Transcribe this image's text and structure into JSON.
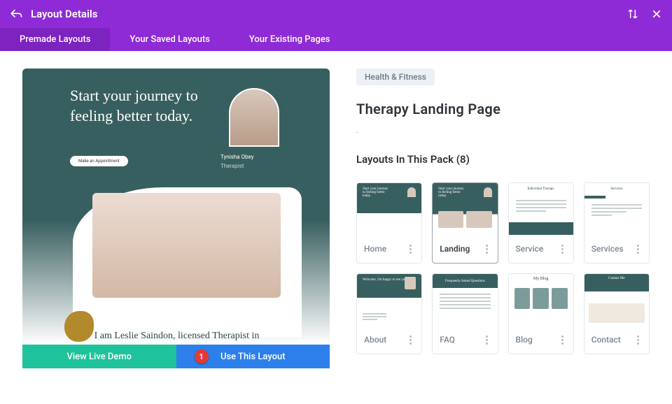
{
  "header": {
    "title": "Layout Details"
  },
  "tabs": [
    {
      "label": "Premade Layouts",
      "active": true
    },
    {
      "label": "Your Saved Layouts",
      "active": false
    },
    {
      "label": "Your Existing Pages",
      "active": false
    }
  ],
  "preview": {
    "heading": "Start your journey to feeling better today.",
    "cta_pill": "Make an Appointment",
    "person_name": "Tynisha Obey",
    "person_role": "Therapist",
    "subtitle": "I am Leslie Saindon, licensed Therapist in"
  },
  "buttons": {
    "demo": "View Live Demo",
    "use": "Use This Layout",
    "marker": "1"
  },
  "details": {
    "category": "Health & Fitness",
    "title": "Therapy Landing Page",
    "subdot": ".",
    "pack_label": "Layouts In This Pack (8)"
  },
  "pack": [
    {
      "label": "Home",
      "thumb": "t-home",
      "active": false
    },
    {
      "label": "Landing",
      "thumb": "t-landing",
      "active": true
    },
    {
      "label": "Service",
      "thumb": "t-service",
      "active": false
    },
    {
      "label": "Services",
      "thumb": "t-services",
      "active": false
    },
    {
      "label": "About",
      "thumb": "t-about",
      "active": false
    },
    {
      "label": "FAQ",
      "thumb": "t-faq",
      "active": false
    },
    {
      "label": "Blog",
      "thumb": "t-blog",
      "active": false
    },
    {
      "label": "Contact",
      "thumb": "t-contact",
      "active": false
    }
  ]
}
